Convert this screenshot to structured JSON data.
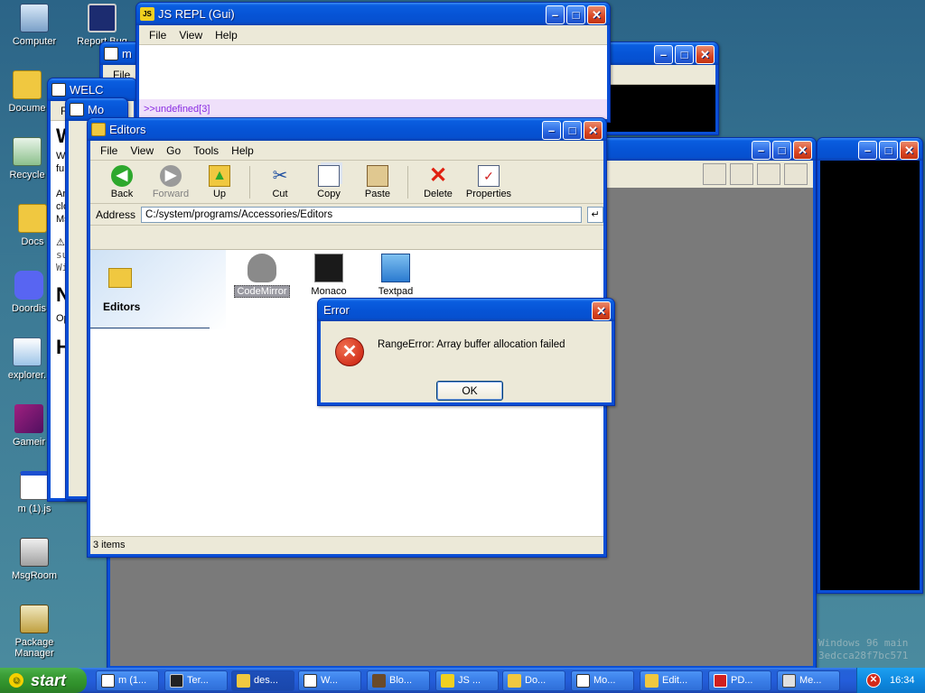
{
  "desktop": {
    "icons": [
      {
        "label": "Computer"
      },
      {
        "label": "Report Bug"
      },
      {
        "label": "Docume"
      },
      {
        "label": "Recycle"
      },
      {
        "label": "Docs"
      },
      {
        "label": "Doordis"
      },
      {
        "label": "explorer."
      },
      {
        "label": "Gameir"
      },
      {
        "label": "m (1).js"
      },
      {
        "label": "MsgRoom"
      },
      {
        "label": "Package Manager"
      }
    ],
    "watermark_line1": "Windows 96 main",
    "watermark_line2": "3edcca28f7bc571"
  },
  "js_repl": {
    "title": "JS REPL (Gui)",
    "menu": [
      "File",
      "View",
      "Help"
    ],
    "output": ">>undefined[3]"
  },
  "back_window_m": {
    "title": "m",
    "menu": [
      "File"
    ]
  },
  "welcome_window": {
    "title": "WELC",
    "menu_first": "Fi",
    "text_fragments": [
      "W",
      "W",
      "fu",
      "Ar",
      "clo",
      "Ms",
      "⚠",
      "su",
      "Wi",
      "N",
      "Op",
      "H"
    ]
  },
  "mo_window": {
    "title": "Mo"
  },
  "explorer": {
    "title": "Editors",
    "menu": [
      "File",
      "View",
      "Go",
      "Tools",
      "Help"
    ],
    "toolbar": [
      {
        "label": "Back",
        "icon": "back-arrow-icon",
        "enabled": true
      },
      {
        "label": "Forward",
        "icon": "forward-arrow-icon",
        "enabled": false
      },
      {
        "label": "Up",
        "icon": "up-folder-icon",
        "enabled": true
      },
      {
        "label": "Cut",
        "icon": "scissors-icon",
        "enabled": true
      },
      {
        "label": "Copy",
        "icon": "copy-icon",
        "enabled": true
      },
      {
        "label": "Paste",
        "icon": "paste-icon",
        "enabled": true
      },
      {
        "label": "Delete",
        "icon": "delete-x-icon",
        "enabled": true
      },
      {
        "label": "Properties",
        "icon": "properties-icon",
        "enabled": true
      }
    ],
    "address_label": "Address",
    "address_value": "C:/system/programs/Accessories/Editors",
    "sidebar_title": "Editors",
    "files": [
      {
        "label": "CodeMirror",
        "selected": true
      },
      {
        "label": "Monaco",
        "selected": false
      },
      {
        "label": "Textpad",
        "selected": false
      }
    ],
    "status": "3 items"
  },
  "error_dialog": {
    "title": "Error",
    "message": "RangeError: Array buffer allocation failed",
    "ok_label": "OK"
  },
  "taskbar": {
    "start_label": "start",
    "tasks": [
      {
        "label": "m (1...",
        "active": false
      },
      {
        "label": "Ter...",
        "active": false
      },
      {
        "label": "des...",
        "active": true
      },
      {
        "label": "W...",
        "active": false
      },
      {
        "label": "Blo...",
        "active": false
      },
      {
        "label": "JS ...",
        "active": false
      },
      {
        "label": "Do...",
        "active": false
      },
      {
        "label": "Mo...",
        "active": false
      },
      {
        "label": "Edit...",
        "active": false
      },
      {
        "label": "PD...",
        "active": false
      },
      {
        "label": "Me...",
        "active": false
      }
    ],
    "clock": "16:34"
  },
  "colors": {
    "titlebar": "#0654d6",
    "close_button": "#d94521",
    "taskbar": "#245edb",
    "start_button": "#3b9e37",
    "desktop": "#3a6e8f",
    "repl_output_bg": "#efe0fa",
    "repl_output_text": "#8a2be2"
  }
}
